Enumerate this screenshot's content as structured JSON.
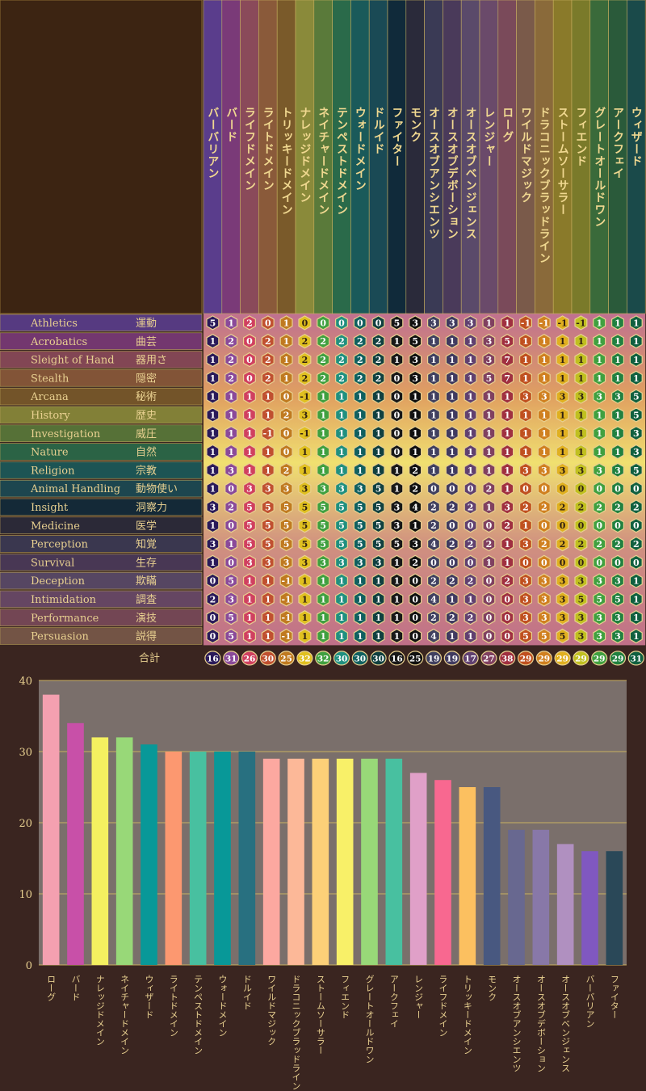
{
  "classes": [
    "バーバリアン",
    "バード",
    "ライフドメイン",
    "ライトドメイン",
    "トリッキードメイン",
    "ナレッジドメイン",
    "ネイチャードメイン",
    "テンペストドメイン",
    "ウォードメイン",
    "ドルイド",
    "ファイター",
    "モンク",
    "オースオブアンシエンツ",
    "オースオブデボーション",
    "オースオブベンジェンス",
    "レンジャー",
    "ローグ",
    "ワイルドマジック",
    "ドラコニックブラッドライン",
    "ストームソーサラー",
    "フィエンド",
    "グレートオールドワン",
    "アークフェイ",
    "ウィザード"
  ],
  "skills": [
    {
      "en": "Athletics",
      "ja": "運動"
    },
    {
      "en": "Acrobatics",
      "ja": "曲芸"
    },
    {
      "en": "Sleight of Hand",
      "ja": "器用さ"
    },
    {
      "en": "Stealth",
      "ja": "隠密"
    },
    {
      "en": "Arcana",
      "ja": "秘術"
    },
    {
      "en": "History",
      "ja": "歴史"
    },
    {
      "en": "Investigation",
      "ja": "威圧"
    },
    {
      "en": "Nature",
      "ja": "自然"
    },
    {
      "en": "Religion",
      "ja": "宗教"
    },
    {
      "en": "Animal Handling",
      "ja": "動物使い"
    },
    {
      "en": "Insight",
      "ja": "洞察力"
    },
    {
      "en": "Medicine",
      "ja": "医学"
    },
    {
      "en": "Perception",
      "ja": "知覚"
    },
    {
      "en": "Survival",
      "ja": "生存"
    },
    {
      "en": "Deception",
      "ja": "欺瞞"
    },
    {
      "en": "Intimidation",
      "ja": "調査"
    },
    {
      "en": "Performance",
      "ja": "演技"
    },
    {
      "en": "Persuasion",
      "ja": "説得"
    }
  ],
  "matrix": [
    [
      "5",
      "1",
      "2",
      "0",
      "1",
      "0",
      "0",
      "0",
      "0",
      "0",
      "5",
      "3",
      "3",
      "3",
      "3",
      "1",
      "1",
      "-1",
      "-1",
      "-1",
      "-1",
      "1",
      "1",
      "1"
    ],
    [
      "1",
      "2",
      "0",
      "2",
      "1",
      "2",
      "2",
      "2",
      "2",
      "2",
      "1",
      "5",
      "1",
      "1",
      "1",
      "3",
      "5",
      "1",
      "1",
      "1",
      "1",
      "1",
      "1",
      "1"
    ],
    [
      "1",
      "2",
      "0",
      "2",
      "1",
      "2",
      "2",
      "2",
      "2",
      "2",
      "1",
      "3",
      "1",
      "1",
      "1",
      "3",
      "7",
      "1",
      "1",
      "1",
      "1",
      "1",
      "1",
      "1"
    ],
    [
      "1",
      "2",
      "0",
      "2",
      "1",
      "2",
      "2",
      "2",
      "2",
      "2",
      "0",
      "3",
      "1",
      "1",
      "1",
      "5",
      "7",
      "1",
      "1",
      "1",
      "1",
      "1",
      "1",
      "1"
    ],
    [
      "1",
      "1",
      "1",
      "1",
      "0",
      "-1",
      "1",
      "1",
      "1",
      "1",
      "0",
      "1",
      "1",
      "1",
      "1",
      "1",
      "1",
      "3",
      "3",
      "3",
      "3",
      "3",
      "3",
      "5"
    ],
    [
      "1",
      "1",
      "1",
      "1",
      "2",
      "3",
      "1",
      "1",
      "1",
      "1",
      "0",
      "1",
      "1",
      "1",
      "1",
      "1",
      "1",
      "1",
      "1",
      "1",
      "1",
      "1",
      "1",
      "5"
    ],
    [
      "1",
      "1",
      "1",
      "-1",
      "0",
      "-1",
      "1",
      "1",
      "1",
      "1",
      "0",
      "1",
      "1",
      "1",
      "1",
      "1",
      "1",
      "1",
      "1",
      "1",
      "1",
      "1",
      "1",
      "3"
    ],
    [
      "1",
      "1",
      "1",
      "1",
      "0",
      "1",
      "1",
      "1",
      "1",
      "1",
      "0",
      "1",
      "1",
      "1",
      "1",
      "1",
      "1",
      "1",
      "1",
      "1",
      "1",
      "1",
      "1",
      "3"
    ],
    [
      "1",
      "3",
      "1",
      "1",
      "2",
      "1",
      "1",
      "1",
      "1",
      "1",
      "1",
      "2",
      "1",
      "1",
      "1",
      "1",
      "1",
      "3",
      "3",
      "3",
      "3",
      "3",
      "3",
      "5"
    ],
    [
      "1",
      "0",
      "3",
      "3",
      "3",
      "3",
      "3",
      "3",
      "3",
      "5",
      "1",
      "2",
      "0",
      "0",
      "0",
      "2",
      "1",
      "0",
      "0",
      "0",
      "0",
      "0",
      "0",
      "0"
    ],
    [
      "3",
      "2",
      "5",
      "5",
      "5",
      "5",
      "5",
      "5",
      "5",
      "5",
      "3",
      "4",
      "2",
      "2",
      "2",
      "1",
      "3",
      "2",
      "2",
      "2",
      "2",
      "2",
      "2",
      "2"
    ],
    [
      "1",
      "0",
      "5",
      "5",
      "5",
      "5",
      "5",
      "5",
      "5",
      "5",
      "3",
      "1",
      "2",
      "0",
      "0",
      "0",
      "2",
      "1",
      "0",
      "0",
      "0",
      "0",
      "0",
      "0"
    ],
    [
      "3",
      "1",
      "5",
      "5",
      "5",
      "5",
      "5",
      "5",
      "5",
      "5",
      "5",
      "3",
      "4",
      "2",
      "2",
      "2",
      "1",
      "3",
      "2",
      "2",
      "2",
      "2",
      "2",
      "2"
    ],
    [
      "1",
      "0",
      "3",
      "3",
      "3",
      "3",
      "3",
      "3",
      "3",
      "3",
      "1",
      "2",
      "0",
      "0",
      "0",
      "1",
      "1",
      "0",
      "0",
      "0",
      "0",
      "0",
      "0",
      "0"
    ],
    [
      "0",
      "5",
      "1",
      "1",
      "-1",
      "1",
      "1",
      "1",
      "1",
      "1",
      "1",
      "0",
      "2",
      "2",
      "2",
      "0",
      "2",
      "3",
      "3",
      "3",
      "3",
      "3",
      "3",
      "1"
    ],
    [
      "2",
      "3",
      "1",
      "1",
      "-1",
      "1",
      "1",
      "1",
      "1",
      "1",
      "1",
      "0",
      "4",
      "1",
      "1",
      "0",
      "0",
      "3",
      "3",
      "3",
      "5",
      "5",
      "5",
      "1"
    ],
    [
      "0",
      "5",
      "1",
      "1",
      "-1",
      "1",
      "1",
      "1",
      "1",
      "1",
      "1",
      "0",
      "2",
      "2",
      "2",
      "0",
      "0",
      "3",
      "3",
      "3",
      "3",
      "3",
      "3",
      "1"
    ],
    [
      "0",
      "5",
      "1",
      "1",
      "-1",
      "1",
      "1",
      "1",
      "1",
      "1",
      "1",
      "0",
      "4",
      "1",
      "1",
      "0",
      "0",
      "5",
      "5",
      "5",
      "3",
      "3",
      "3",
      "1"
    ]
  ],
  "total_label": "合計",
  "totals": [
    "16",
    "31",
    "26",
    "30",
    "25",
    "32",
    "32",
    "30",
    "30",
    "30",
    "16",
    "25",
    "19",
    "19",
    "17",
    "27",
    "38",
    "29",
    "29",
    "29",
    "29",
    "29",
    "29",
    "31"
  ],
  "colors": {
    "class_columns": [
      "#5a3d8c",
      "#7a3a78",
      "#8a4a5a",
      "#8a5a3a",
      "#7a5a2a",
      "#8a8a3a",
      "#5a7a3a",
      "#2a6a4a",
      "#1a5a5a",
      "#1a4a55",
      "#102a3a",
      "#2a2a3a",
      "#3a3a55",
      "#4a3a5a",
      "#5a4a6a",
      "#6a4a6a",
      "#7a4a5a",
      "#7a5a4a",
      "#8a6a3a",
      "#8a7a2a",
      "#7a7a2a",
      "#3a6a3a",
      "#2a5a3a",
      "#1a4a4a"
    ],
    "token_fill": [
      "#2a1a5a",
      "#8a4a9a",
      "#d04060",
      "#c05030",
      "#c07a20",
      "#e0c020",
      "#40a040",
      "#209080",
      "#106060",
      "#104040",
      "#181818",
      "#101010",
      "#404060",
      "#403a60",
      "#604070",
      "#804060",
      "#a03040",
      "#c05020",
      "#d08020",
      "#e0b020",
      "#c0c020",
      "#40a040",
      "#208040",
      "#106040"
    ],
    "bar": [
      "#f4a0b0",
      "#c850a8",
      "#f4f060",
      "#98d878",
      "#089898",
      "#fc9870",
      "#48c0a0",
      "#089898",
      "#287080",
      "#fca8a0",
      "#fcb898",
      "#fcd078",
      "#f8f068",
      "#98d878",
      "#48c0a0",
      "#e0a0c8",
      "#f86890",
      "#fcc060",
      "#485880",
      "#686890",
      "#8878a8",
      "#b090c0",
      "#8058c0",
      "#2a4858"
    ],
    "bg": "#3a2520",
    "plot_bg": "#7a6f6b",
    "grid": "#c8b060",
    "label": "#e8d090"
  },
  "chart_data": {
    "type": "bar",
    "categories": [
      "ローグ",
      "バード",
      "ナレッジドメイン",
      "ネイチャードメイン",
      "ウィザード",
      "ライトドメイン",
      "テンペストドメイン",
      "ウォードメイン",
      "ドルイド",
      "ワイルドマジック",
      "ドラコニックブラッドライン",
      "ストームソーサラー",
      "フィエンド",
      "グレートオールドワン",
      "アークフェイ",
      "レンジャー",
      "ライフドメイン",
      "トリッキードメイン",
      "モンク",
      "オースオブアンシエンツ",
      "オースオブデボーション",
      "オースオブベンジェンス",
      "バーバリアン",
      "ファイター"
    ],
    "values": [
      38,
      34,
      32,
      32,
      31,
      30,
      30,
      30,
      30,
      29,
      29,
      29,
      29,
      29,
      29,
      27,
      26,
      25,
      25,
      19,
      19,
      17,
      16,
      16
    ],
    "ylim": [
      0,
      40
    ],
    "yticks": [
      "0",
      "10",
      "20",
      "30",
      "40"
    ],
    "grid": true
  }
}
